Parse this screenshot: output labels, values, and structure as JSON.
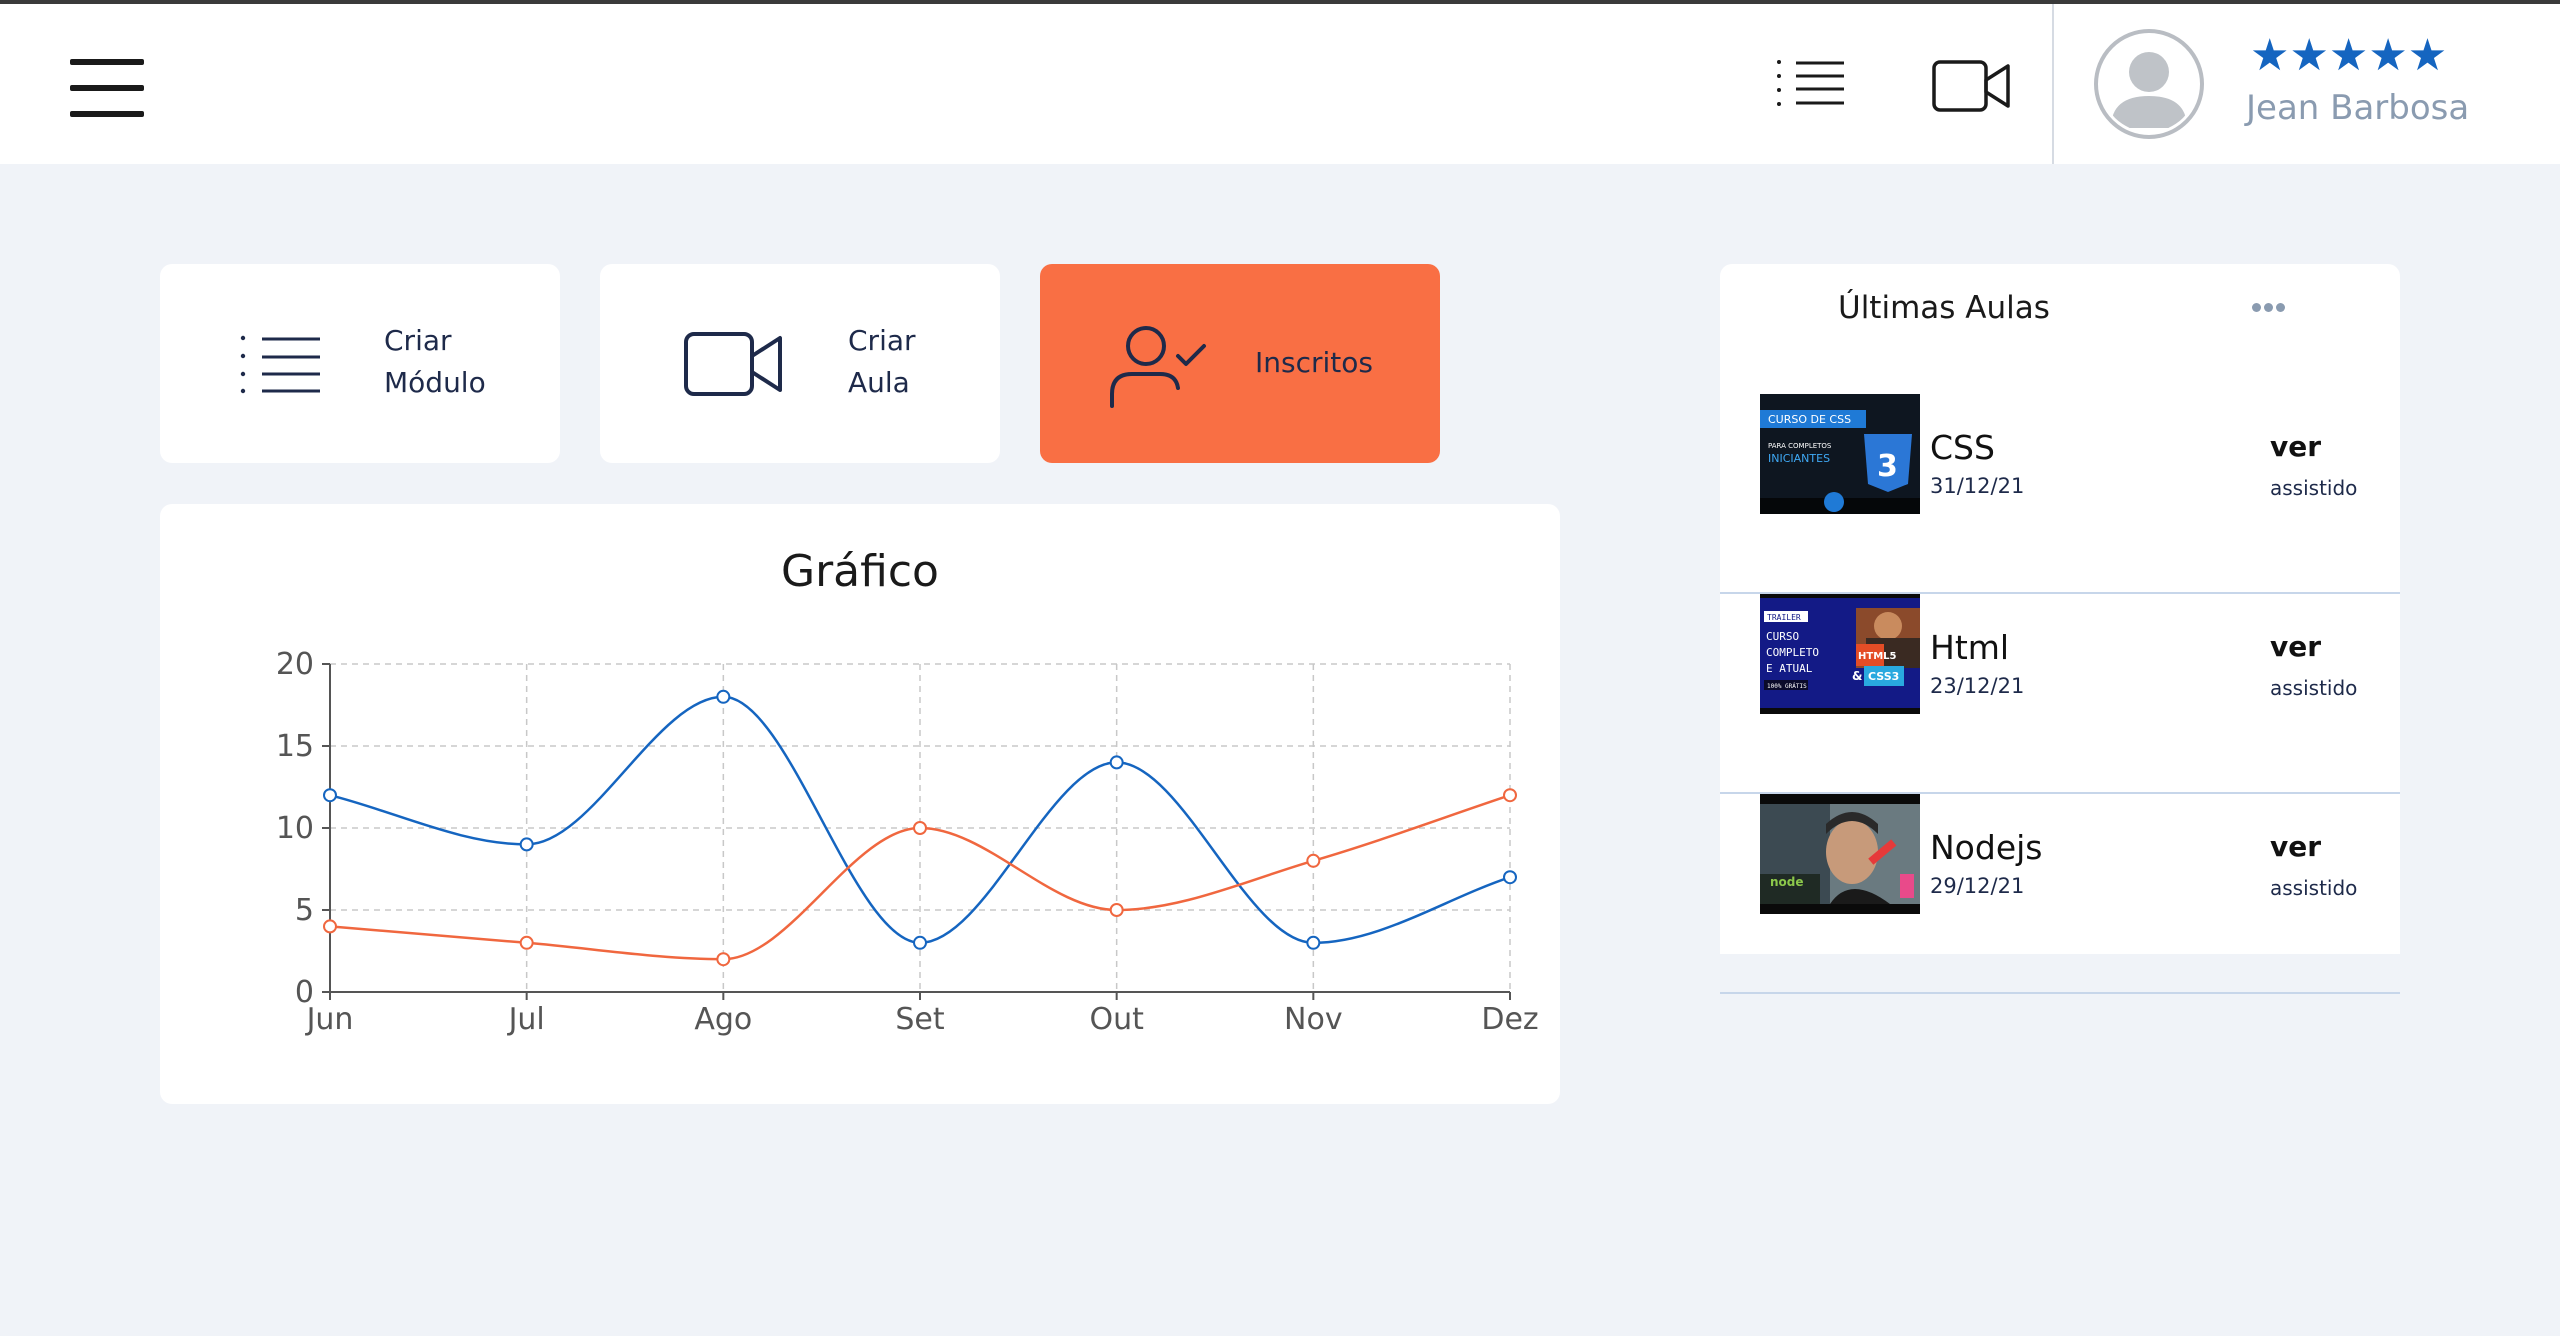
{
  "header": {
    "rating_stars": "★★★★★",
    "rating_value": 5,
    "user_name": "Jean Barbosa"
  },
  "actions": [
    {
      "line1": "Criar",
      "line2": "Módulo",
      "icon": "list-icon"
    },
    {
      "line1": "Criar",
      "line2": "Aula",
      "icon": "video-camera-icon"
    },
    {
      "label": "Inscritos",
      "icon": "user-check-icon",
      "active": true
    }
  ],
  "chart": {
    "title": "Gráfico"
  },
  "chart_data": {
    "type": "line",
    "title": "Gráfico",
    "categories": [
      "Jun",
      "Jul",
      "Ago",
      "Set",
      "Out",
      "Nov",
      "Dez"
    ],
    "ylim": [
      0,
      20
    ],
    "yticks": [
      0,
      5,
      10,
      15,
      20
    ],
    "grid": true,
    "series": [
      {
        "values": [
          12,
          9,
          18,
          3,
          14,
          3,
          7
        ],
        "color": "#1565c0"
      },
      {
        "values": [
          4,
          3,
          2,
          10,
          5,
          8,
          12
        ],
        "color": "#f0673f"
      }
    ]
  },
  "lessons": {
    "title": "Últimas Aulas",
    "items": [
      {
        "name": "CSS",
        "date": "31/12/21",
        "action": "ver",
        "status": "assistido",
        "thumb": "css-course-thumbnail"
      },
      {
        "name": "Html",
        "date": "23/12/21",
        "action": "ver",
        "status": "assistido",
        "thumb": "html-course-thumbnail"
      },
      {
        "name": "Nodejs",
        "date": "29/12/21",
        "action": "ver",
        "status": "assistido",
        "thumb": "nodejs-course-thumbnail"
      }
    ]
  },
  "thumb_text": {
    "css_badge": "CURSO DE CSS",
    "css_sub1": "PARA COMPLETOS",
    "css_sub2": "INICIANTES",
    "css_num": "3",
    "html_tag": "TRAILER",
    "html_l1": "CURSO",
    "html_l2": "COMPLETO",
    "html_l3": "E ATUAL",
    "html_l4": "100% GRÁTIS",
    "html_h": "HTML5",
    "html_amp": "&",
    "html_c": "CSS3",
    "node_logo": "node"
  },
  "colors": {
    "accent": "#f96f44",
    "primary_series": "#1565c0",
    "secondary_series": "#f0673f",
    "background": "#f0f3f8"
  }
}
